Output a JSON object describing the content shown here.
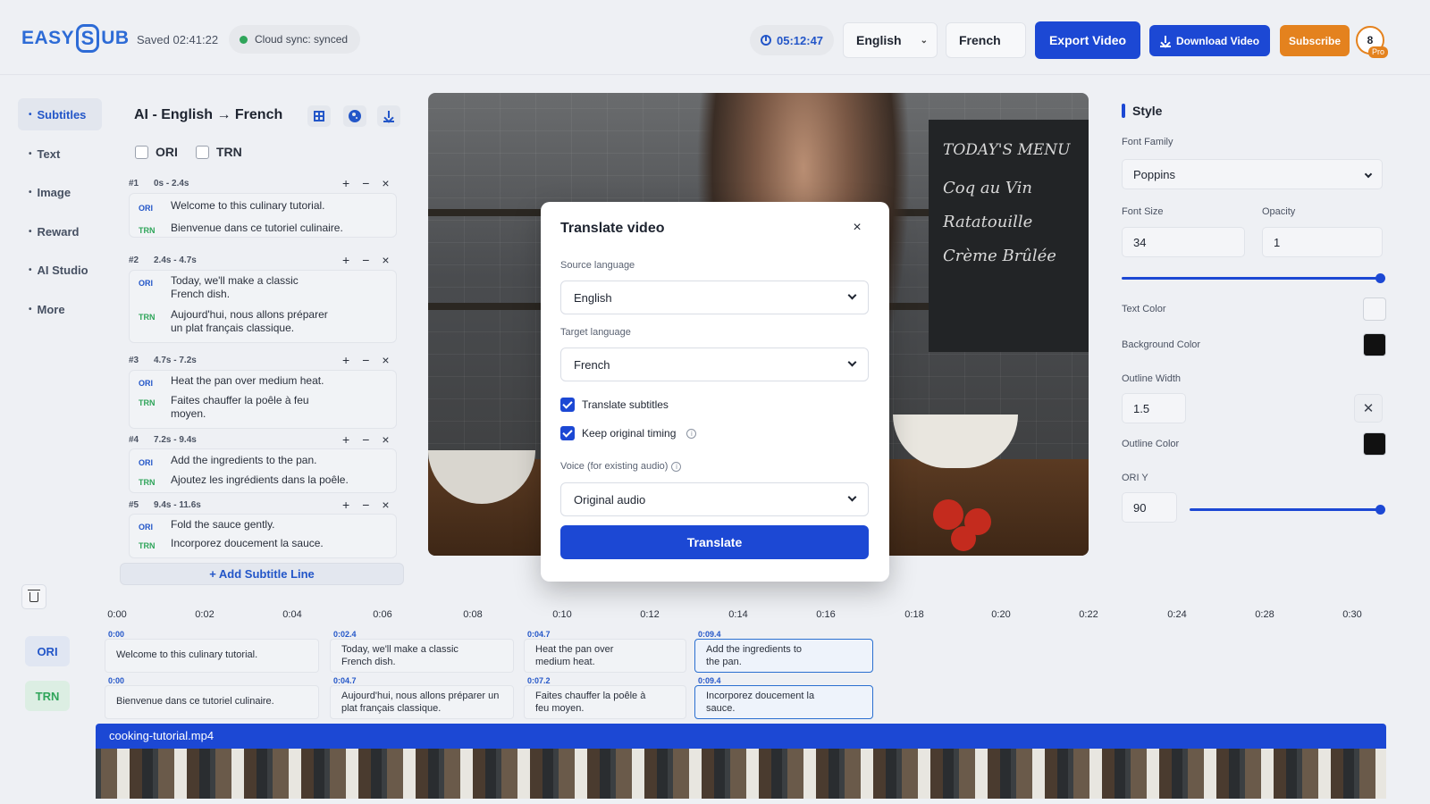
{
  "header": {
    "logo_left": "EASY",
    "logo_mark": "S",
    "logo_right": "UB",
    "saved": "Saved 02:41:22",
    "cloud": "Cloud sync: synced",
    "timer": "05:12:47",
    "source_lang": "English",
    "target_lang": "French",
    "export": "Export Video",
    "download": "Download Video",
    "subscribe": "Subscribe",
    "avatar": "8",
    "pro": "Pro"
  },
  "nav": {
    "items": [
      {
        "label": "Subtitles"
      },
      {
        "label": "Text"
      },
      {
        "label": "Image"
      },
      {
        "label": "Reward"
      },
      {
        "label": "AI Studio"
      },
      {
        "label": "More"
      }
    ]
  },
  "subtitles": {
    "title": "AI - English → French",
    "ori": "ORI",
    "trn": "TRN",
    "add": "+ Add Subtitle Line",
    "entries": [
      {
        "num": "#1",
        "time": "0s - 2.4s",
        "ori": "Welcome to this culinary tutorial.",
        "trn": "Bienvenue dans ce tutoriel culinaire."
      },
      {
        "num": "#2",
        "time": "2.4s - 4.7s",
        "ori": "Today, we'll make a classic French dish.",
        "trn": "Aujourd'hui, nous allons préparer un plat français classique."
      },
      {
        "num": "#3",
        "time": "4.7s - 7.2s",
        "ori": "Heat the pan over medium heat.",
        "trn": "Faites chauffer la poêle à feu moyen."
      },
      {
        "num": "#4",
        "time": "7.2s - 9.4s",
        "ori": "Add the ingredients to the pan.",
        "trn": "Ajoutez les ingrédients dans la poêle."
      },
      {
        "num": "#5",
        "time": "9.4s - 11.6s",
        "ori": "Fold the sauce gently.",
        "trn": "Incorporez doucement la sauce."
      }
    ]
  },
  "video": {
    "menu": [
      "TODAY'S MENU",
      "Coq au Vin",
      "Ratatouille",
      "Crème Brûlée"
    ]
  },
  "modal": {
    "title": "Translate video",
    "close": "×",
    "source_label": "Source language",
    "source_value": "English",
    "target_label": "Target language",
    "target_value": "French",
    "check1": "Translate subtitles",
    "check2": "Keep original timing",
    "voice_label": "Voice (for existing audio)",
    "voice_value": "Original audio",
    "button": "Translate"
  },
  "style": {
    "title": "Style",
    "font_family_label": "Font Family",
    "font_family": "Poppins",
    "font_size_label": "Font Size",
    "font_size": "34",
    "opacity_label": "Opacity",
    "opacity": "1",
    "text_color_label": "Text Color",
    "text_color": "#f4f5f8",
    "bg_color_label": "Background Color",
    "bg_color": "#111111",
    "outline_width_label": "Outline Width",
    "outline_width": "1.5",
    "outline_color_label": "Outline Color",
    "outline_color": "#111111",
    "ori_y_label": "ORI Y",
    "ori_y": "90",
    "accent": "#1c48d4"
  },
  "timeline": {
    "ticks": [
      "0:00",
      "0:02",
      "0:04",
      "0:06",
      "0:08",
      "0:10",
      "0:12",
      "0:14",
      "0:16",
      "0:18",
      "0:20",
      "0:22",
      "0:24",
      "0:28",
      "0:30"
    ],
    "ori_label": "ORI",
    "trn_label": "TRN",
    "ori_clips": [
      {
        "time": "0:00",
        "text": "Welcome to this culinary tutorial."
      },
      {
        "time": "0:02.4",
        "text": "Today, we'll make a classic French dish."
      },
      {
        "time": "0:04.7",
        "text": "Heat the pan over medium heat."
      },
      {
        "time": "0:09.4",
        "text": "Add the ingredients to the pan."
      }
    ],
    "trn_clips": [
      {
        "time": "0:00",
        "text": "Bienvenue dans ce tutoriel culinaire."
      },
      {
        "time": "0:04.7",
        "text": "Aujourd'hui, nous allons préparer un plat français classique."
      },
      {
        "time": "0:07.2",
        "text": "Faites chauffer la poêle à feu moyen."
      },
      {
        "time": "0:09.4",
        "text": "Incorporez doucement la sauce."
      }
    ],
    "file": "cooking-tutorial.mp4"
  }
}
